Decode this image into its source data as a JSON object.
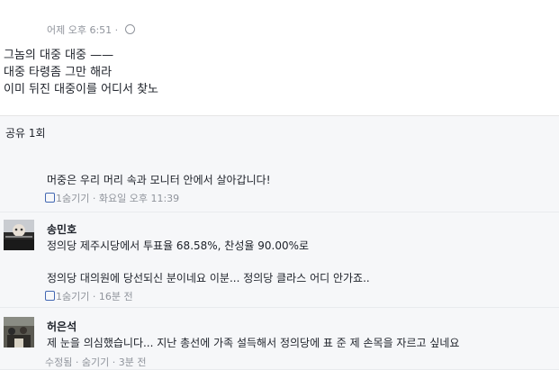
{
  "post": {
    "timestamp": "어제 오후 6:51 ·",
    "lines": [
      "그놈의 대중 대중 ——",
      "대중 타령좀 그만 해라",
      "이미 뒤진 대중이를 어디서 찾노"
    ]
  },
  "shares": "공유 1회",
  "comments": [
    {
      "author": "",
      "text": "머중은 우리 머리 속과 모니터 안에서 살아갑니다!",
      "actions": "1숨기기 · 화요일 오후 11:39"
    },
    {
      "author": "송민호",
      "text": "정의당 제주시당에서 투표율 68.58%, 찬성율 90.00%로",
      "text2": "정의당 대의원에 당선되신 분이네요 이분... 정의당 클라스 어디 안가죠..",
      "actions": "1숨기기 · 16분 전"
    },
    {
      "author": "허은석",
      "text": "제 눈을 의심했습니다... 지난 총선에 가족 설득해서 정의당에 표 준 제 손목을 자르고 싶네요",
      "actions": "수정됨 · 숨기기 · 3분 전"
    }
  ]
}
